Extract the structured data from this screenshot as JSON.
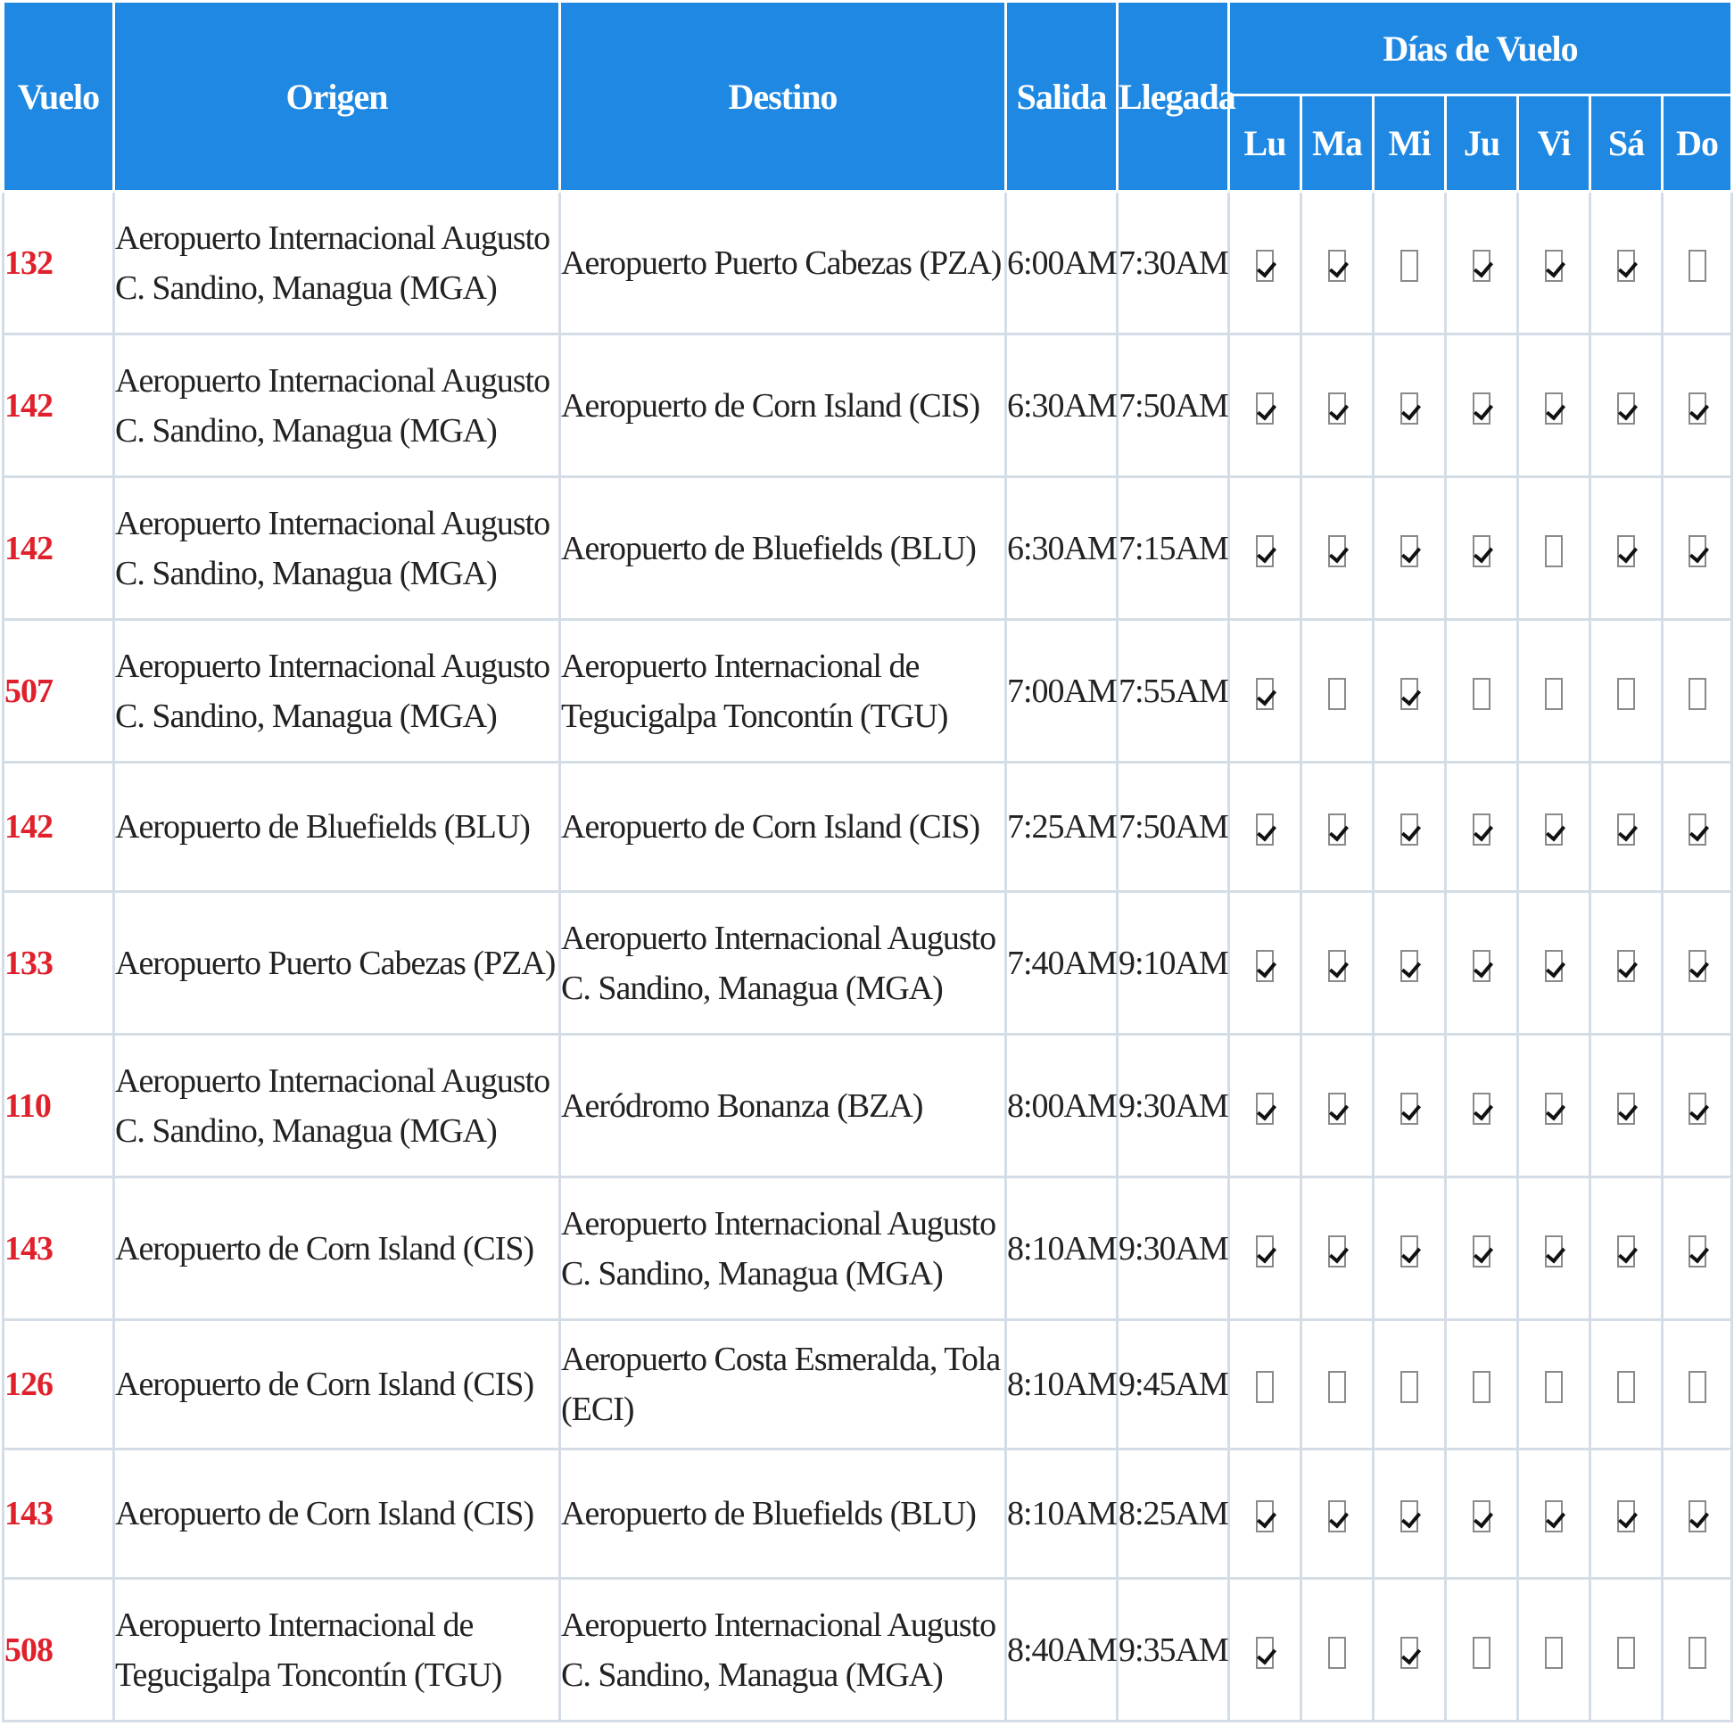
{
  "headers": {
    "vuelo": "Vuelo",
    "origen": "Origen",
    "destino": "Destino",
    "salida": "Salida",
    "llegada": "Llegada",
    "dias_group": "Días de Vuelo",
    "days": [
      "Lu",
      "Ma",
      "Mi",
      "Ju",
      "Vi",
      "Sá",
      "Do"
    ]
  },
  "colors": {
    "header_bg": "#1e88e2",
    "flight_number": "#e0202b",
    "grid_line": "#d4dde6"
  },
  "rows": [
    {
      "vuelo": "132",
      "origen": "Aeropuerto Internacional Augusto C. Sandino, Managua (MGA)",
      "destino": "Aeropuerto Puerto Cabezas (PZA)",
      "salida": "6:00AM",
      "llegada": "7:30AM",
      "days": [
        true,
        true,
        false,
        true,
        true,
        true,
        false
      ]
    },
    {
      "vuelo": "142",
      "origen": "Aeropuerto Internacional Augusto C. Sandino, Managua (MGA)",
      "destino": "Aeropuerto de Corn Island (CIS)",
      "salida": "6:30AM",
      "llegada": "7:50AM",
      "days": [
        true,
        true,
        true,
        true,
        true,
        true,
        true
      ]
    },
    {
      "vuelo": "142",
      "origen": "Aeropuerto Internacional Augusto C. Sandino, Managua (MGA)",
      "destino": "Aeropuerto de Bluefields (BLU)",
      "salida": "6:30AM",
      "llegada": "7:15AM",
      "days": [
        true,
        true,
        true,
        true,
        false,
        true,
        true
      ]
    },
    {
      "vuelo": "507",
      "origen": "Aeropuerto Internacional Augusto C. Sandino, Managua (MGA)",
      "destino": "Aeropuerto Internacional de Tegucigalpa Toncontín (TGU)",
      "salida": "7:00AM",
      "llegada": "7:55AM",
      "days": [
        true,
        false,
        true,
        false,
        false,
        false,
        false
      ]
    },
    {
      "vuelo": "142",
      "origen": "Aeropuerto de Bluefields (BLU)",
      "destino": "Aeropuerto de Corn Island (CIS)",
      "salida": "7:25AM",
      "llegada": "7:50AM",
      "days": [
        true,
        true,
        true,
        true,
        true,
        true,
        true
      ]
    },
    {
      "vuelo": "133",
      "origen": "Aeropuerto Puerto Cabezas (PZA)",
      "destino": "Aeropuerto Internacional Augusto C. Sandino, Managua (MGA)",
      "salida": "7:40AM",
      "llegada": "9:10AM",
      "days": [
        true,
        true,
        true,
        true,
        true,
        true,
        true
      ]
    },
    {
      "vuelo": "110",
      "origen": "Aeropuerto Internacional Augusto C. Sandino, Managua (MGA)",
      "destino": "Aeródromo Bonanza (BZA)",
      "salida": "8:00AM",
      "llegada": "9:30AM",
      "days": [
        true,
        true,
        true,
        true,
        true,
        true,
        true
      ]
    },
    {
      "vuelo": "143",
      "origen": "Aeropuerto de Corn Island (CIS)",
      "destino": "Aeropuerto Internacional Augusto C. Sandino, Managua (MGA)",
      "salida": "8:10AM",
      "llegada": "9:30AM",
      "days": [
        true,
        true,
        true,
        true,
        true,
        true,
        true
      ]
    },
    {
      "vuelo": "126",
      "origen": "Aeropuerto de Corn Island (CIS)",
      "destino": "Aeropuerto Costa Esmeralda, Tola (ECI)",
      "salida": "8:10AM",
      "llegada": "9:45AM",
      "days": [
        false,
        false,
        false,
        false,
        false,
        false,
        false
      ]
    },
    {
      "vuelo": "143",
      "origen": "Aeropuerto de Corn Island (CIS)",
      "destino": "Aeropuerto de Bluefields (BLU)",
      "salida": "8:10AM",
      "llegada": "8:25AM",
      "days": [
        true,
        true,
        true,
        true,
        true,
        true,
        true
      ]
    },
    {
      "vuelo": "508",
      "origen": "Aeropuerto Internacional de Tegucigalpa Toncontín (TGU)",
      "destino": "Aeropuerto Internacional Augusto C. Sandino, Managua (MGA)",
      "salida": "8:40AM",
      "llegada": "9:35AM",
      "days": [
        true,
        false,
        true,
        false,
        false,
        false,
        false
      ]
    }
  ]
}
